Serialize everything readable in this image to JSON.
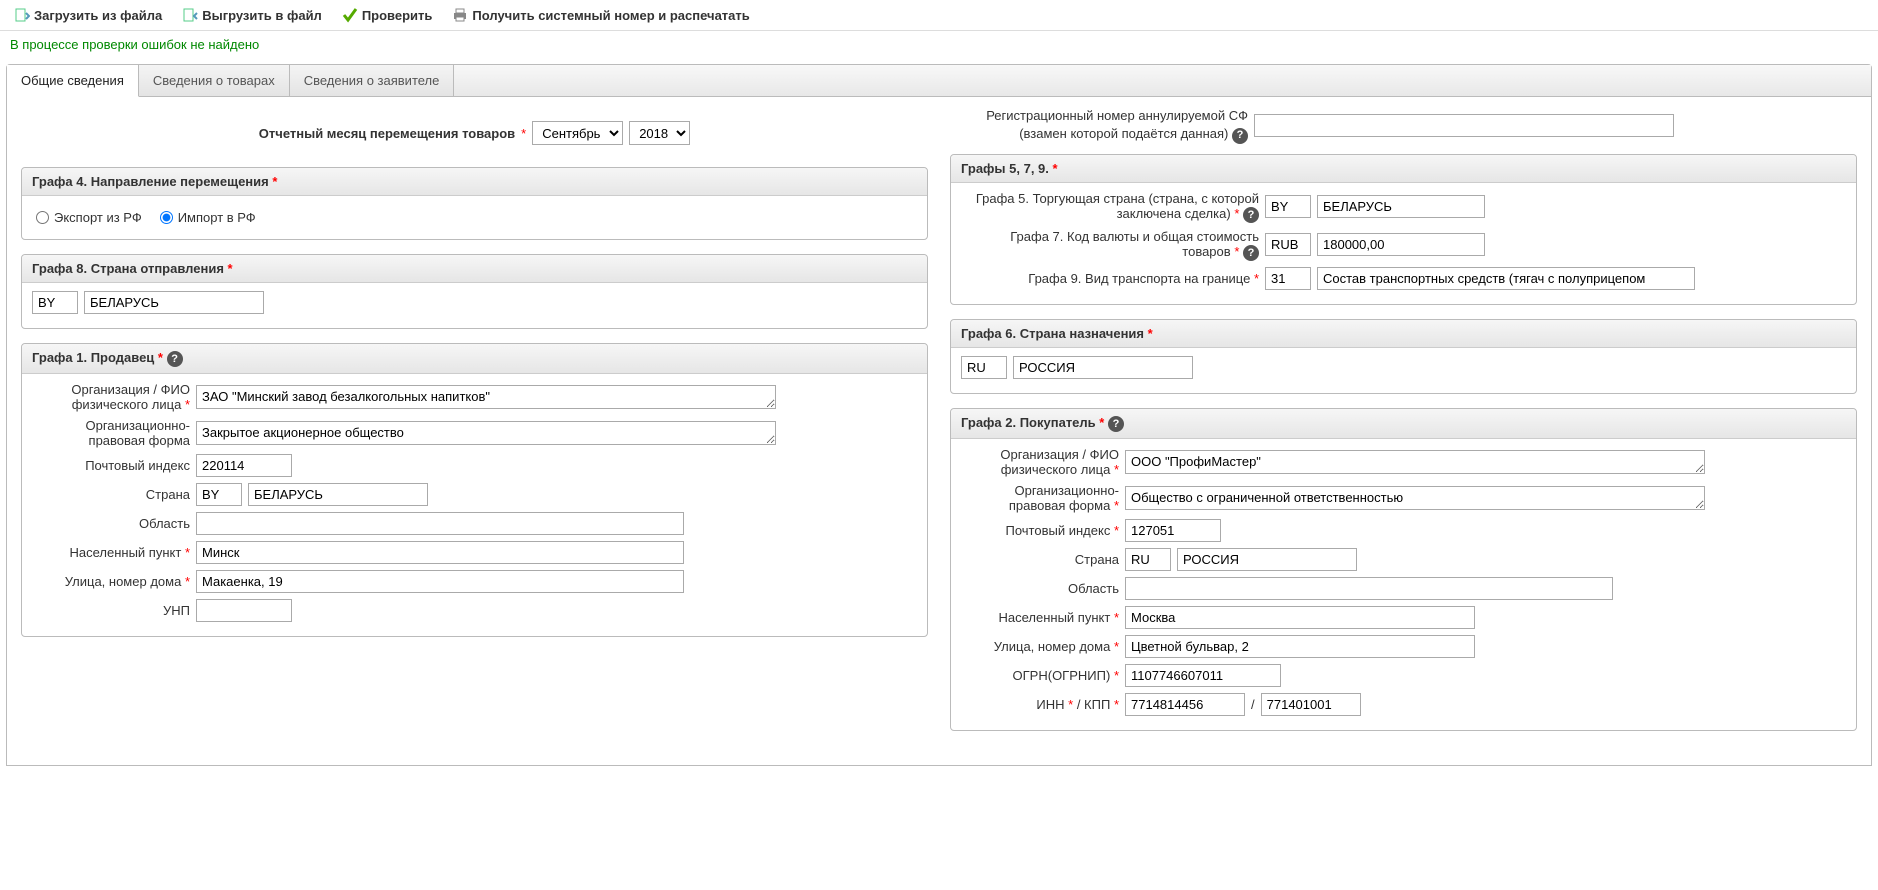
{
  "toolbar": {
    "load": "Загрузить из файла",
    "save": "Выгрузить в файл",
    "check": "Проверить",
    "print": "Получить системный номер и распечатать"
  },
  "status": "В процессе проверки ошибок не найдено",
  "tabs": {
    "general": "Общие сведения",
    "goods": "Сведения о товарах",
    "applicant": "Сведения о заявителе"
  },
  "month_label": "Отчетный месяц перемещения товаров",
  "month": "Сентябрь",
  "year": "2018",
  "reg_cancel_a": "Регистрационный номер аннулируемой СФ",
  "reg_cancel_b": "(взамен которой подаётся данная)",
  "g579": {
    "title": "Графы 5, 7, 9.",
    "g5": "Графа 5. Торгующая страна (страна, с которой заключена сделка)",
    "g5_code": "BY",
    "g5_name": "БЕЛАРУСЬ",
    "g7": "Графа 7. Код валюты и общая стоимость товаров",
    "g7_code": "RUB",
    "g7_val": "180000,00",
    "g9": "Графа 9. Вид транспорта на границе",
    "g9_code": "31",
    "g9_name": "Состав транспортных средств (тягач с полуприцепом"
  },
  "g4": {
    "title": "Графа 4. Направление перемещения",
    "export": "Экспорт из РФ",
    "import": "Импорт в РФ"
  },
  "g8": {
    "title": "Графа 8. Страна отправления",
    "code": "BY",
    "name": "БЕЛАРУСЬ"
  },
  "g6": {
    "title": "Графа 6. Страна назначения",
    "code": "RU",
    "name": "РОССИЯ"
  },
  "g1": {
    "title": "Графа 1. Продавец",
    "org": "ЗАО \"Минский завод безалкогольных напитков\"",
    "form": "Закрытое акционерное общество",
    "post": "220114",
    "country_code": "BY",
    "country_name": "БЕЛАРУСЬ",
    "region": "",
    "city": "Минск",
    "street": "Макаенка, 19",
    "unp": ""
  },
  "g2": {
    "title": "Графа 2. Покупатель",
    "org": "ООО \"ПрофиМастер\"",
    "form": "Общество с ограниченной ответственностью",
    "post": "127051",
    "country_code": "RU",
    "country_name": "РОССИЯ",
    "region": "",
    "city": "Москва",
    "street": "Цветной бульвар, 2",
    "ogrn": "1107746607011",
    "inn": "7714814456",
    "kpp": "771401001"
  },
  "labels": {
    "org1": "Организация / ФИО",
    "org2": "физического лица",
    "legal1": "Организационно-",
    "legal2": "правовая форма",
    "post": "Почтовый индекс",
    "country": "Страна",
    "region": "Область",
    "city": "Населенный пункт",
    "street": "Улица, номер дома",
    "unp": "УНП",
    "ogrn": "ОГРН(ОГРНИП)",
    "inn": "ИНН",
    "kpp": "КПП"
  }
}
